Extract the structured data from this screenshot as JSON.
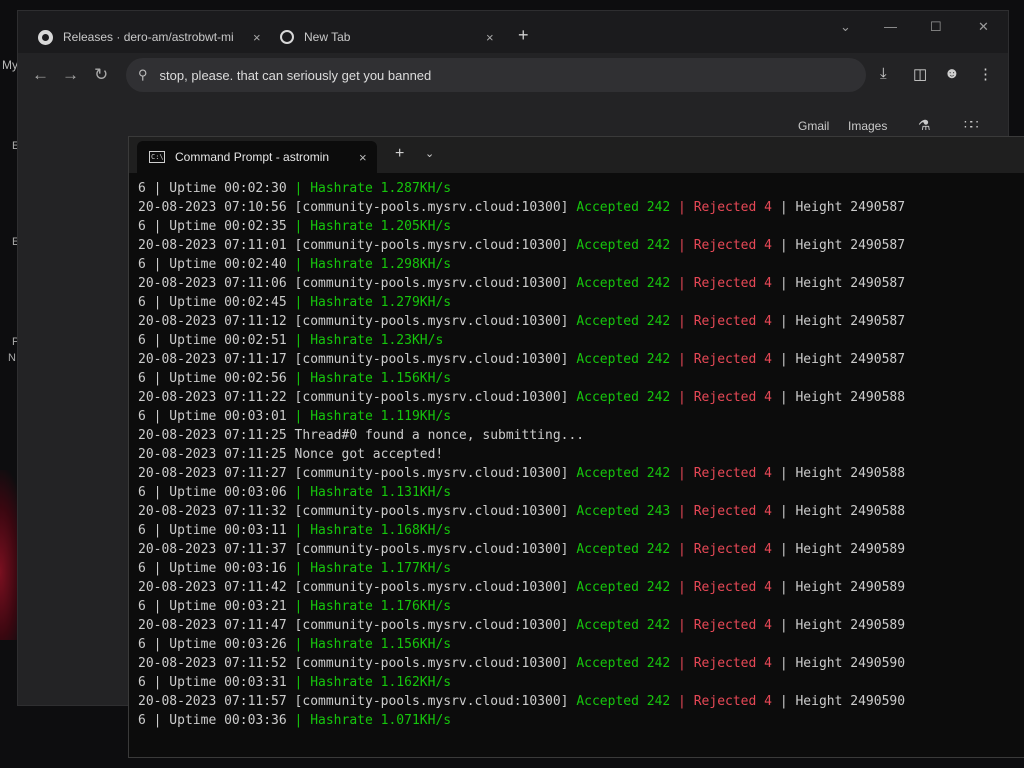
{
  "desktop": {
    "label": "My",
    "marks": [
      "E",
      "E",
      "P",
      "N"
    ]
  },
  "browser": {
    "tabs": [
      {
        "title": "Releases · dero-am/astrobwt-mi",
        "close": "×"
      },
      {
        "title": "New Tab",
        "close": "×"
      }
    ],
    "new_tab": "+",
    "window_controls": [
      "⌄",
      "—",
      "☐",
      "✕"
    ],
    "nav": {
      "back": "←",
      "forward": "→",
      "reload": "↻"
    },
    "omnibox": {
      "value": "stop, please. that can seriously get you banned"
    },
    "google": {
      "gmail": "Gmail",
      "images": "Images"
    }
  },
  "terminal": {
    "tab_title": "Command Prompt - astromin",
    "tab_close": "×",
    "new_tab": "+",
    "dropdown": "⌄",
    "lines": [
      {
        "type": "stat",
        "uptime": "00:02:30",
        "rate": "1.287KH/s"
      },
      {
        "type": "log",
        "ts": "20-08-2023 07:10:56",
        "pool": "[community-pools.mysrv.cloud:10300]",
        "acc": "Accepted 242",
        "rej": "Rejected 4",
        "height": "Height 2490587"
      },
      {
        "type": "stat",
        "uptime": "00:02:35",
        "rate": "1.205KH/s"
      },
      {
        "type": "log",
        "ts": "20-08-2023 07:11:01",
        "pool": "[community-pools.mysrv.cloud:10300]",
        "acc": "Accepted 242",
        "rej": "Rejected 4",
        "height": "Height 2490587"
      },
      {
        "type": "stat",
        "uptime": "00:02:40",
        "rate": "1.298KH/s"
      },
      {
        "type": "log",
        "ts": "20-08-2023 07:11:06",
        "pool": "[community-pools.mysrv.cloud:10300]",
        "acc": "Accepted 242",
        "rej": "Rejected 4",
        "height": "Height 2490587"
      },
      {
        "type": "stat",
        "uptime": "00:02:45",
        "rate": "1.279KH/s"
      },
      {
        "type": "log",
        "ts": "20-08-2023 07:11:12",
        "pool": "[community-pools.mysrv.cloud:10300]",
        "acc": "Accepted 242",
        "rej": "Rejected 4",
        "height": "Height 2490587"
      },
      {
        "type": "stat",
        "uptime": "00:02:51",
        "rate": "1.23KH/s"
      },
      {
        "type": "log",
        "ts": "20-08-2023 07:11:17",
        "pool": "[community-pools.mysrv.cloud:10300]",
        "acc": "Accepted 242",
        "rej": "Rejected 4",
        "height": "Height 2490587"
      },
      {
        "type": "stat",
        "uptime": "00:02:56",
        "rate": "1.156KH/s"
      },
      {
        "type": "log",
        "ts": "20-08-2023 07:11:22",
        "pool": "[community-pools.mysrv.cloud:10300]",
        "acc": "Accepted 242",
        "rej": "Rejected 4",
        "height": "Height 2490588"
      },
      {
        "type": "stat",
        "uptime": "00:03:01",
        "rate": "1.119KH/s"
      },
      {
        "type": "plain",
        "text": "20-08-2023 07:11:25 Thread#0 found a nonce, submitting..."
      },
      {
        "type": "plain",
        "text": "20-08-2023 07:11:25 Nonce got accepted!"
      },
      {
        "type": "log",
        "ts": "20-08-2023 07:11:27",
        "pool": "[community-pools.mysrv.cloud:10300]",
        "acc": "Accepted 242",
        "rej": "Rejected 4",
        "height": "Height 2490588"
      },
      {
        "type": "stat",
        "uptime": "00:03:06",
        "rate": "1.131KH/s"
      },
      {
        "type": "log",
        "ts": "20-08-2023 07:11:32",
        "pool": "[community-pools.mysrv.cloud:10300]",
        "acc": "Accepted 243",
        "rej": "Rejected 4",
        "height": "Height 2490588"
      },
      {
        "type": "stat",
        "uptime": "00:03:11",
        "rate": "1.168KH/s"
      },
      {
        "type": "log",
        "ts": "20-08-2023 07:11:37",
        "pool": "[community-pools.mysrv.cloud:10300]",
        "acc": "Accepted 242",
        "rej": "Rejected 4",
        "height": "Height 2490589"
      },
      {
        "type": "stat",
        "uptime": "00:03:16",
        "rate": "1.177KH/s"
      },
      {
        "type": "log",
        "ts": "20-08-2023 07:11:42",
        "pool": "[community-pools.mysrv.cloud:10300]",
        "acc": "Accepted 242",
        "rej": "Rejected 4",
        "height": "Height 2490589"
      },
      {
        "type": "stat",
        "uptime": "00:03:21",
        "rate": "1.176KH/s"
      },
      {
        "type": "log",
        "ts": "20-08-2023 07:11:47",
        "pool": "[community-pools.mysrv.cloud:10300]",
        "acc": "Accepted 242",
        "rej": "Rejected 4",
        "height": "Height 2490589"
      },
      {
        "type": "stat",
        "uptime": "00:03:26",
        "rate": "1.156KH/s"
      },
      {
        "type": "log",
        "ts": "20-08-2023 07:11:52",
        "pool": "[community-pools.mysrv.cloud:10300]",
        "acc": "Accepted 242",
        "rej": "Rejected 4",
        "height": "Height 2490590"
      },
      {
        "type": "stat",
        "uptime": "00:03:31",
        "rate": "1.162KH/s"
      },
      {
        "type": "log",
        "ts": "20-08-2023 07:11:57",
        "pool": "[community-pools.mysrv.cloud:10300]",
        "acc": "Accepted 242",
        "rej": "Rejected 4",
        "height": "Height 2490590"
      },
      {
        "type": "stat",
        "uptime": "00:03:36",
        "rate": "1.071KH/s"
      }
    ],
    "stat_prefix": "6 | Uptime ",
    "stat_sep": " | ",
    "stat_rate_prefix": "Hashrate ",
    "log_sep": " | ",
    "colors": {
      "accepted": "#16c60c",
      "rejected": "#e74856",
      "text": "#cccccc",
      "background": "#0c0c0c"
    }
  }
}
